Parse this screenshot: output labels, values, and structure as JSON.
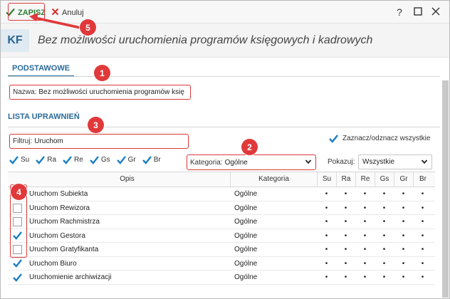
{
  "toolbar": {
    "save_label": "ZAPISZ",
    "cancel_label": "Anuluj",
    "help_glyph": "?"
  },
  "header": {
    "badge": "KF",
    "title": "Bez możliwości uruchomienia programów księgowych i kadrowych"
  },
  "tabs": [
    {
      "label": "PODSTAWOWE",
      "active": true
    }
  ],
  "name_field": {
    "label": "Nazwa:",
    "value": "Bez możliwości uruchomienia programów księ"
  },
  "permissions": {
    "section_title": "LISTA UPRAWNIEŃ",
    "filter": {
      "label": "Filtruj:",
      "value": "Uruchom"
    },
    "select_all_label": "Zaznacz/odznacz wszystkie",
    "select_all_checked": true,
    "column_toggles": [
      {
        "label": "Su",
        "checked": true
      },
      {
        "label": "Ra",
        "checked": true
      },
      {
        "label": "Re",
        "checked": true
      },
      {
        "label": "Gs",
        "checked": true
      },
      {
        "label": "Gr",
        "checked": true
      },
      {
        "label": "Br",
        "checked": true
      }
    ],
    "category": {
      "label": "Kategoria:",
      "value": "Ogólne"
    },
    "show": {
      "label": "Pokazuj:",
      "value": "Wszystkie"
    },
    "columns": [
      "Opis",
      "Kategoria",
      "Su",
      "Ra",
      "Re",
      "Gs",
      "Gr",
      "Br"
    ],
    "rows": [
      {
        "checked": null,
        "opis": "Uruchom Subiekta",
        "kategoria": "Ogólne",
        "marks": [
          "•",
          "•",
          "•",
          "•",
          "•",
          "•"
        ]
      },
      {
        "checked": false,
        "opis": "Uruchom Rewizora",
        "kategoria": "Ogólne",
        "marks": [
          "•",
          "•",
          "•",
          "•",
          "•",
          "•"
        ]
      },
      {
        "checked": false,
        "opis": "Uruchom Rachmistrza",
        "kategoria": "Ogólne",
        "marks": [
          "•",
          "•",
          "•",
          "•",
          "•",
          "•"
        ]
      },
      {
        "checked": true,
        "opis": "Uruchom Gestora",
        "kategoria": "Ogólne",
        "marks": [
          "•",
          "•",
          "•",
          "•",
          "•",
          "•"
        ]
      },
      {
        "checked": false,
        "opis": "Uruchom Gratyfikanta",
        "kategoria": "Ogólne",
        "marks": [
          "•",
          "•",
          "•",
          "•",
          "•",
          "•"
        ]
      },
      {
        "checked": true,
        "opis": "Uruchom Biuro",
        "kategoria": "Ogólne",
        "marks": [
          "•",
          "•",
          "•",
          "•",
          "•",
          "•"
        ]
      },
      {
        "checked": true,
        "opis": "Uruchomienie archiwizacji",
        "kategoria": "Ogólne",
        "marks": [
          "•",
          "•",
          "•",
          "•",
          "•",
          "•"
        ]
      }
    ]
  },
  "annotations": [
    "1",
    "2",
    "3",
    "4",
    "5"
  ],
  "colors": {
    "accent": "#2c6a98",
    "check_blue": "#1d7fc4",
    "save_green": "#2e7d32",
    "cancel_red": "#d32f2f",
    "annotation_red": "#e0393b"
  }
}
